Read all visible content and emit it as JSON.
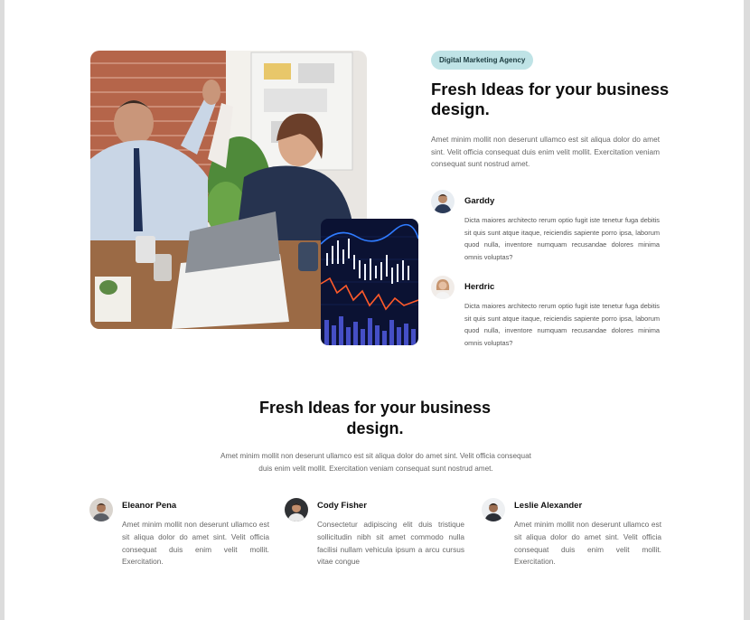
{
  "hero": {
    "badge": "Digital Marketing Agency",
    "title": "Fresh Ideas for your business design.",
    "description": "Amet minim mollit non deserunt ullamco est sit aliqua dolor do amet sint. Velit officia consequat duis enim velit mollit. Exercitation veniam consequat sunt nostrud amet.",
    "people": [
      {
        "name": "Garddy",
        "text": "Dicta maiores architecto rerum optio fugit iste tenetur fuga debitis sit quis sunt atque itaque, reiciendis sapiente porro ipsa, laborum quod nulla, inventore numquam recusandae dolores minima omnis voluptas?"
      },
      {
        "name": "Herdric",
        "text": "Dicta maiores architecto rerum optio fugit iste tenetur fuga debitis sit quis sunt atque itaque, reiciendis sapiente porro ipsa, laborum quod nulla, inventore numquam recusandae dolores minima omnis voluptas?"
      }
    ]
  },
  "section": {
    "title": "Fresh Ideas for your business design.",
    "description": "Amet minim mollit non deserunt ullamco est sit aliqua dolor do amet sint. Velit officia consequat duis enim velit mollit. Exercitation veniam consequat sunt nostrud amet."
  },
  "testimonials": [
    {
      "name": "Eleanor Pena",
      "text": "Amet minim mollit non deserunt ullamco est sit aliqua dolor do amet sint. Velit officia consequat duis enim velit mollit. Exercitation."
    },
    {
      "name": "Cody Fisher",
      "text": "Consectetur adipiscing elit duis tristique sollicitudin nibh sit amet commodo nulla facilisi nullam vehicula ipsum a arcu cursus vitae congue"
    },
    {
      "name": "Leslie Alexander",
      "text": "Amet minim mollit non deserunt ullamco est sit aliqua dolor do amet sint. Velit officia consequat duis enim velit mollit. Exercitation."
    }
  ],
  "colors": {
    "badge_bg": "#bfe3e6",
    "heading": "#0d0d0d",
    "body_text": "#666666"
  }
}
